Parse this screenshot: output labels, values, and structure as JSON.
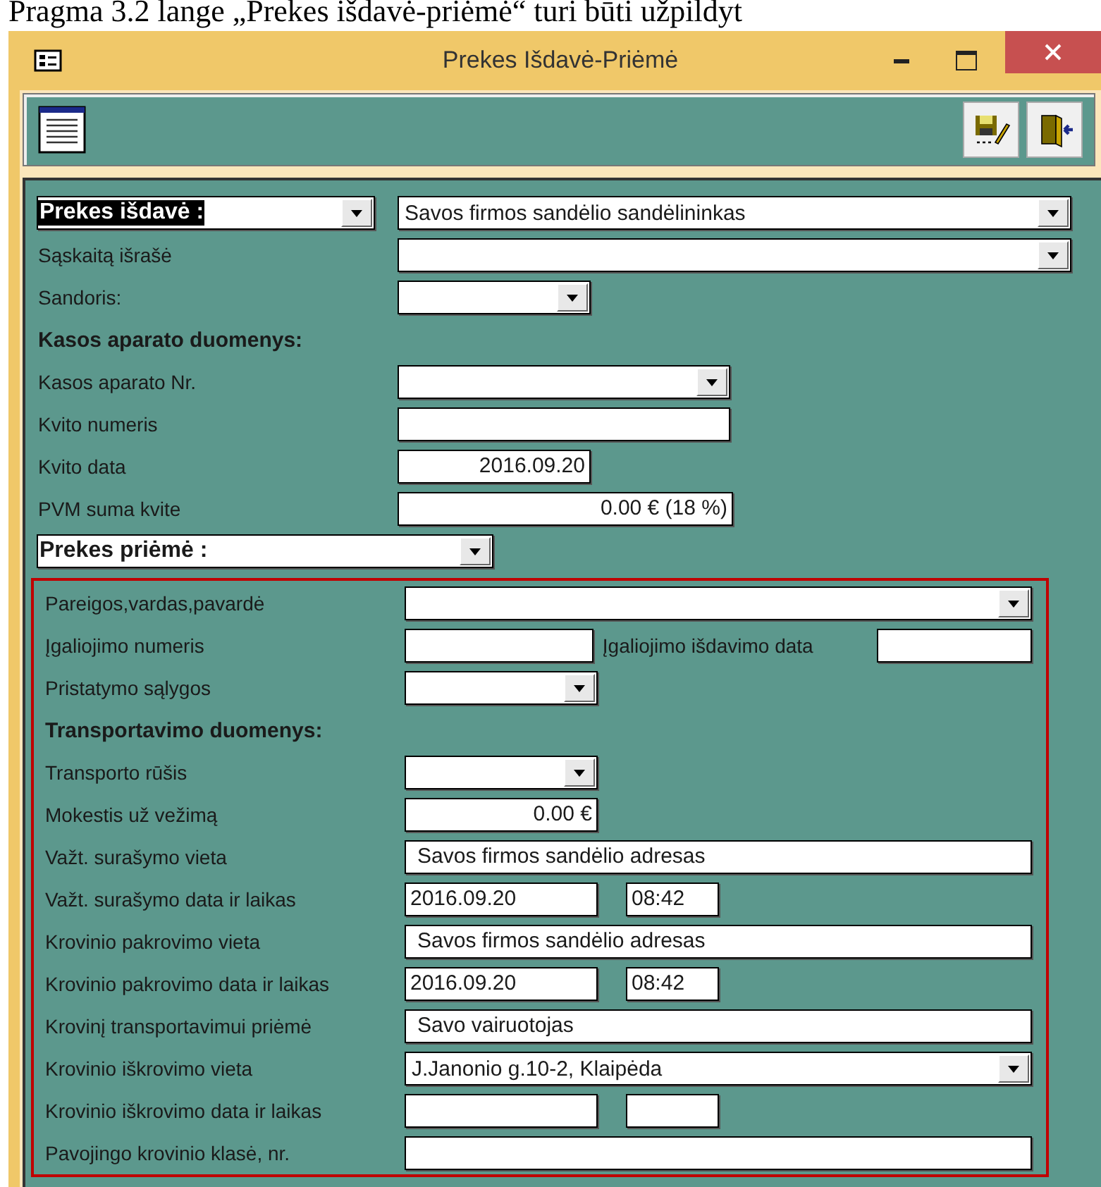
{
  "caption": "Pragma 3.2 lange „Prekes išdavė-priėmė“ turi būti užpildyt",
  "window": {
    "title": "Prekes Išdavė-Priėmė"
  },
  "issuer": {
    "label": "Prekes išdavė :",
    "highlighted": true,
    "value": "Savos firmos sandėlio sandėlininkas"
  },
  "rows": [
    {
      "kind": "combo",
      "label": "Sąskaitą išrašė"
    },
    {
      "kind": "combo",
      "label": "Sandoris:"
    },
    {
      "kind": "heading",
      "label": "Kasos aparato duomenys:"
    },
    {
      "kind": "combo",
      "label": "Kasos aparato Nr."
    },
    {
      "kind": "input",
      "label": "Kvito numeris"
    },
    {
      "kind": "amount",
      "label": "Kvito data",
      "value": "2016.09.20"
    },
    {
      "kind": "amount",
      "label": "PVM suma kvite",
      "value": "0.00 € (18 %)"
    }
  ],
  "receiver": {
    "label": "Prekes priėmė :"
  },
  "receiver_rows": [
    {
      "kind": "combo",
      "label": "Pareigos,vardas,pavardė"
    },
    {
      "kind": "double",
      "label": "Įgaliojimo numeris",
      "label_2": "Įgaliojimo išdavimo data"
    },
    {
      "kind": "combo",
      "label": "Pristatymo sąlygos"
    },
    {
      "kind": "heading",
      "label": "Transportavimo duomenys:"
    },
    {
      "kind": "combo",
      "label": "Transporto rūšis"
    },
    {
      "kind": "amount",
      "label": "Mokestis už vežimą",
      "value": "0.00 €"
    },
    {
      "kind": "input",
      "label": "Važt. surašymo vieta",
      "value": "Savos firmos sandėlio adresas"
    },
    {
      "kind": "pair",
      "label": "Važt. surašymo data ir laikas",
      "value": "2016.09.20",
      "value_2": "08:42"
    },
    {
      "kind": "input",
      "label": "Krovinio pakrovimo vieta",
      "value": "Savos firmos sandėlio adresas"
    },
    {
      "kind": "pair",
      "label": "Krovinio pakrovimo data ir laikas",
      "value": "2016.09.20",
      "value_2": "08:42"
    },
    {
      "kind": "input",
      "label": "Krovinį transportavimui priėmė",
      "value": "Savo vairuotojas"
    },
    {
      "kind": "combo",
      "label": "Krovinio iškrovimo vieta",
      "value": "J.Janonio g.10-2, Klaipėda"
    },
    {
      "kind": "pair",
      "label": "Krovinio iškrovimo data ir laikas"
    },
    {
      "kind": "input",
      "label": "Pavojingo krovinio klasė, nr."
    }
  ]
}
